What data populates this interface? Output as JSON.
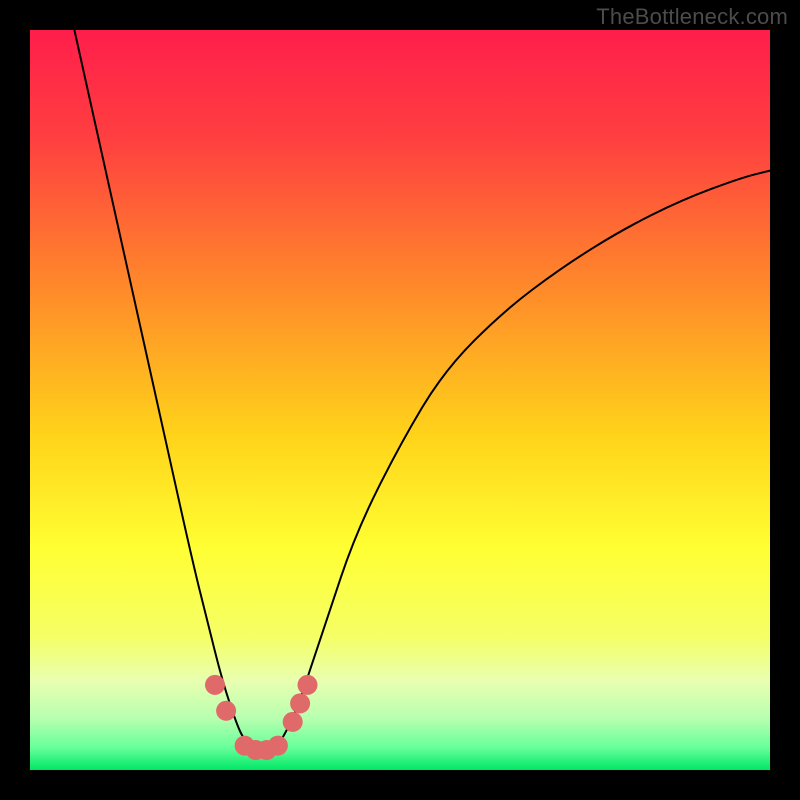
{
  "watermark": "TheBottleneck.com",
  "chart_data": {
    "type": "line",
    "title": "",
    "xlabel": "",
    "ylabel": "",
    "xlim": [
      0,
      100
    ],
    "ylim": [
      0,
      100
    ],
    "background_gradient": {
      "stops": [
        {
          "offset": 0.0,
          "color": "#ff1e4b"
        },
        {
          "offset": 0.15,
          "color": "#ff4040"
        },
        {
          "offset": 0.35,
          "color": "#ff8a2a"
        },
        {
          "offset": 0.55,
          "color": "#ffd41a"
        },
        {
          "offset": 0.7,
          "color": "#ffff33"
        },
        {
          "offset": 0.82,
          "color": "#f5ff66"
        },
        {
          "offset": 0.88,
          "color": "#e8ffb0"
        },
        {
          "offset": 0.93,
          "color": "#b8ffb0"
        },
        {
          "offset": 0.97,
          "color": "#66ff99"
        },
        {
          "offset": 1.0,
          "color": "#00e766"
        }
      ]
    },
    "series": [
      {
        "name": "bottleneck-curve",
        "color": "#000000",
        "stroke_width": 2,
        "x": [
          6,
          10,
          14,
          18,
          22,
          24,
          26,
          28,
          29,
          30,
          31,
          32,
          33,
          34,
          36,
          38,
          40,
          44,
          50,
          56,
          64,
          72,
          80,
          88,
          96,
          100
        ],
        "y": [
          100,
          82,
          64,
          46,
          28,
          20,
          12,
          6,
          4,
          3,
          2.5,
          2.5,
          3,
          4,
          8,
          14,
          20,
          32,
          44,
          54,
          62,
          68,
          73,
          77,
          80,
          81
        ]
      }
    ],
    "markers": {
      "name": "highlight-points",
      "color": "#e06a6a",
      "radius": 10,
      "points": [
        {
          "x": 25.0,
          "y": 11.5
        },
        {
          "x": 26.5,
          "y": 8.0
        },
        {
          "x": 29.0,
          "y": 3.3
        },
        {
          "x": 30.5,
          "y": 2.7
        },
        {
          "x": 32.0,
          "y": 2.7
        },
        {
          "x": 33.5,
          "y": 3.3
        },
        {
          "x": 35.5,
          "y": 6.5
        },
        {
          "x": 36.5,
          "y": 9.0
        },
        {
          "x": 37.5,
          "y": 11.5
        }
      ]
    }
  }
}
